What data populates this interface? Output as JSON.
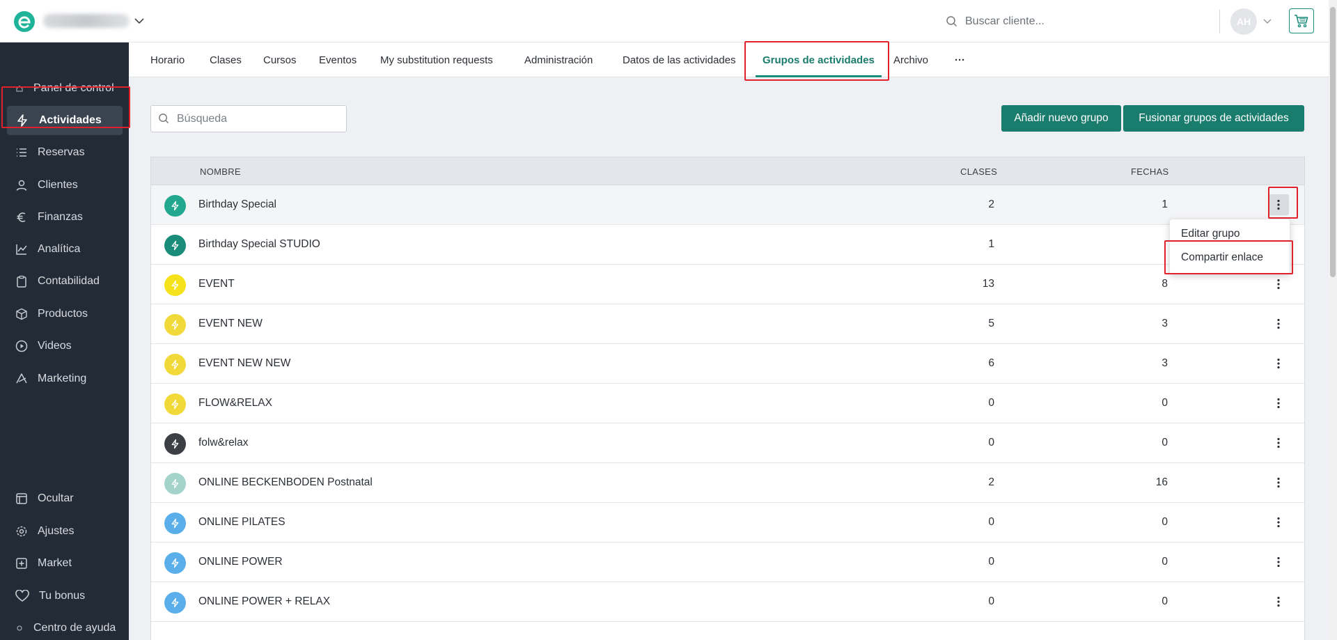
{
  "header": {
    "search_placeholder": "Buscar cliente...",
    "avatar_initials": "AH"
  },
  "sidebar": {
    "items": [
      {
        "label": "Panel de control",
        "icon": "home-icon"
      },
      {
        "label": "Actividades",
        "icon": "lightning-icon",
        "active": true
      },
      {
        "label": "Reservas",
        "icon": "list-icon"
      },
      {
        "label": "Clientes",
        "icon": "user-icon"
      },
      {
        "label": "Finanzas",
        "icon": "euro-icon"
      },
      {
        "label": "Analítica",
        "icon": "chart-icon"
      },
      {
        "label": "Contabilidad",
        "icon": "clipboard-icon"
      },
      {
        "label": "Productos",
        "icon": "box-icon"
      },
      {
        "label": "Videos",
        "icon": "play-icon"
      },
      {
        "label": "Marketing",
        "icon": "megaphone-icon"
      }
    ],
    "bottom_items": [
      {
        "label": "Ocultar",
        "icon": "collapse-icon"
      },
      {
        "label": "Ajustes",
        "icon": "gear-icon"
      },
      {
        "label": "Market",
        "icon": "plus-square-icon"
      },
      {
        "label": "Tu bonus",
        "icon": "heart-icon"
      },
      {
        "label": "Centro de ayuda",
        "icon": "help-icon"
      }
    ]
  },
  "tabs": [
    {
      "label": "Horario"
    },
    {
      "label": "Clases"
    },
    {
      "label": "Cursos"
    },
    {
      "label": "Eventos"
    },
    {
      "label": "My substitution requests"
    },
    {
      "label": "Administración"
    },
    {
      "label": "Datos de las actividades"
    },
    {
      "label": "Grupos de actividades",
      "active": true
    },
    {
      "label": "Archivo"
    },
    {
      "label": "···"
    }
  ],
  "toolbar": {
    "search_placeholder": "Búsqueda",
    "add_group_label": "Añadir nuevo grupo",
    "merge_groups_label": "Fusionar grupos de actividades"
  },
  "table": {
    "columns": {
      "name": "NOMBRE",
      "clases": "CLASES",
      "fechas": "FECHAS"
    },
    "rows": [
      {
        "name": "Birthday Special",
        "clases": "2",
        "fechas": "1",
        "color": "#22a88f"
      },
      {
        "name": "Birthday Special STUDIO",
        "clases": "1",
        "fechas": "",
        "color": "#1a8c7a"
      },
      {
        "name": "EVENT",
        "clases": "13",
        "fechas": "8",
        "color": "#f5e21a"
      },
      {
        "name": "EVENT NEW",
        "clases": "5",
        "fechas": "3",
        "color": "#f2d93a"
      },
      {
        "name": "EVENT NEW NEW",
        "clases": "6",
        "fechas": "3",
        "color": "#f2d93a"
      },
      {
        "name": "FLOW&RELAX",
        "clases": "0",
        "fechas": "0",
        "color": "#f2d93a"
      },
      {
        "name": "folw&relax",
        "clases": "0",
        "fechas": "0",
        "color": "#3c3f44"
      },
      {
        "name": "ONLINE BECKENBODEN Postnatal",
        "clases": "2",
        "fechas": "16",
        "color": "#a4d3cc"
      },
      {
        "name": "ONLINE PILATES",
        "clases": "0",
        "fechas": "0",
        "color": "#5aaeea"
      },
      {
        "name": "ONLINE POWER",
        "clases": "0",
        "fechas": "0",
        "color": "#5aaeea"
      },
      {
        "name": "ONLINE POWER + RELAX",
        "clases": "0",
        "fechas": "0",
        "color": "#5aaeea"
      }
    ]
  },
  "dropdown": {
    "edit_label": "Editar grupo",
    "share_label": "Compartir enlace"
  }
}
